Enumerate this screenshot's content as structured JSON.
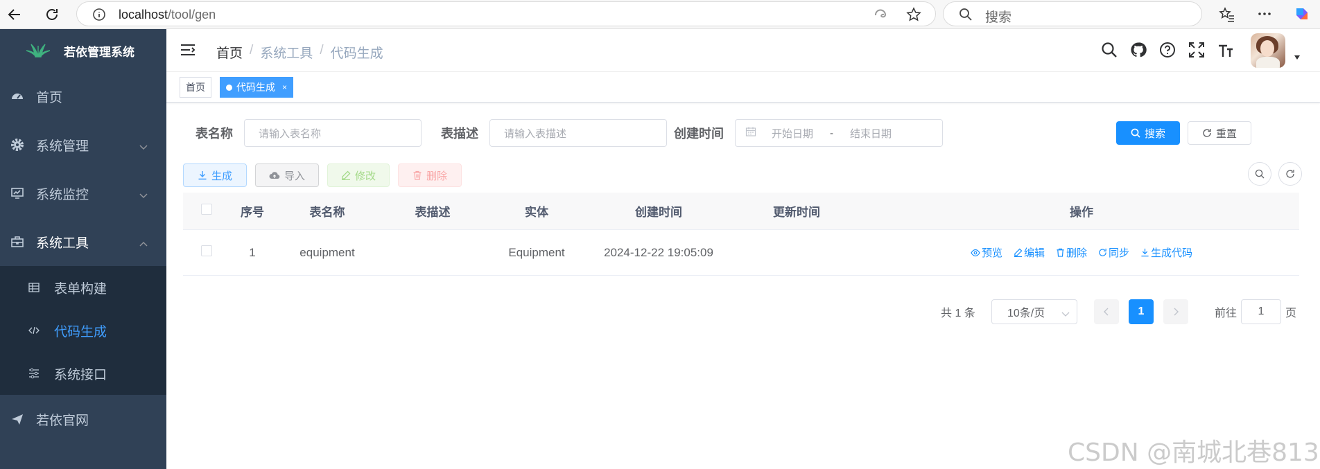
{
  "browser": {
    "url_host": "localhost",
    "url_path": "/tool/gen",
    "search_placeholder": "搜索"
  },
  "sidebar": {
    "logo_title": "若依管理系统",
    "items": [
      {
        "label": "首页",
        "icon": "dashboard-icon"
      },
      {
        "label": "系统管理",
        "icon": "gear-icon"
      },
      {
        "label": "系统监控",
        "icon": "monitor-icon"
      },
      {
        "label": "系统工具",
        "icon": "toolbox-icon",
        "expanded": true
      },
      {
        "label": "若依官网",
        "icon": "send-icon"
      }
    ],
    "sub_items": [
      {
        "label": "表单构建",
        "icon": "table-icon"
      },
      {
        "label": "代码生成",
        "icon": "code-icon",
        "active": true
      },
      {
        "label": "系统接口",
        "icon": "sliders-icon"
      }
    ]
  },
  "navbar": {
    "breadcrumb": [
      "首页",
      "系统工具",
      "代码生成"
    ],
    "icons": [
      "search-icon",
      "github-icon",
      "question-icon",
      "fullscreen-icon",
      "font-size-icon"
    ]
  },
  "tags": [
    {
      "label": "首页",
      "active": false
    },
    {
      "label": "代码生成",
      "active": true,
      "close": "×"
    }
  ],
  "filters": {
    "table_name_label": "表名称",
    "table_name_placeholder": "请输入表名称",
    "table_desc_label": "表描述",
    "table_desc_placeholder": "请输入表描述",
    "created_label": "创建时间",
    "start_placeholder": "开始日期",
    "range_sep": "-",
    "end_placeholder": "结束日期",
    "search_btn": "搜索",
    "reset_btn": "重置"
  },
  "toolbar": {
    "generate": "生成",
    "import": "导入",
    "edit": "修改",
    "delete": "删除"
  },
  "table": {
    "headers": [
      "序号",
      "表名称",
      "表描述",
      "实体",
      "创建时间",
      "更新时间",
      "操作"
    ],
    "rows": [
      {
        "index": "1",
        "table_name": "equipment",
        "table_desc": "",
        "entity": "Equipment",
        "created": "2024-12-22 19:05:09",
        "updated": ""
      }
    ],
    "actions": [
      "预览",
      "编辑",
      "删除",
      "同步",
      "生成代码"
    ]
  },
  "pagination": {
    "total": "共 1 条",
    "page_size": "10条/页",
    "current": "1",
    "goto_label": "前往",
    "goto_value": "1",
    "page_unit": "页"
  },
  "watermark": "CSDN @南城北巷813",
  "colors": {
    "sidebar_bg": "#304156",
    "submenu_bg": "#1f2d3d",
    "primary": "#1890ff",
    "active_menu": "#409eff"
  }
}
